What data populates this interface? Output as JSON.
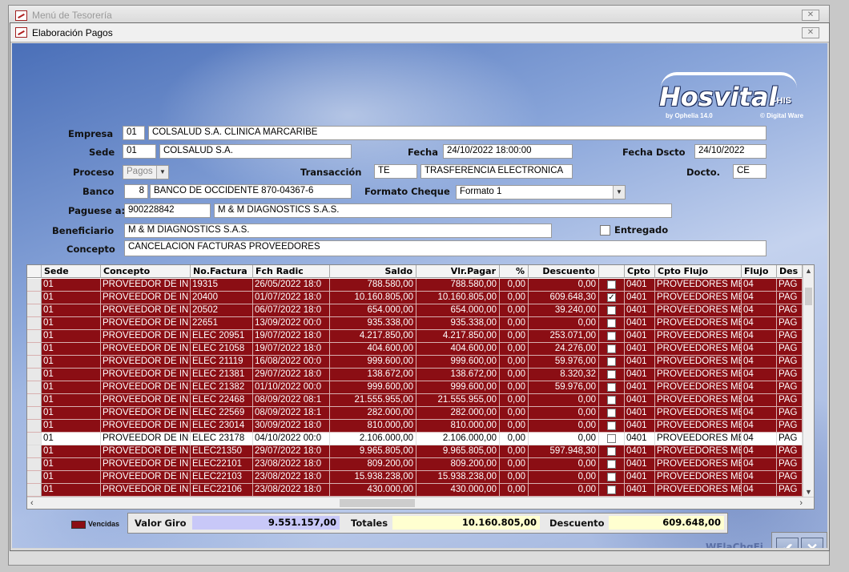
{
  "parent_window": {
    "title": "Menú de Tesorería"
  },
  "dialog": {
    "title": "Elaboración Pagos"
  },
  "logo": {
    "name": "Hosvital",
    "suffix": "-HIS",
    "by": "by Ophelia 14.0",
    "vendor": "© Digital Ware"
  },
  "form": {
    "empresa": {
      "label": "Empresa",
      "code": "01",
      "name": "COLSALUD S.A. CLINICA MARCARIBE"
    },
    "sede": {
      "label": "Sede",
      "code": "01",
      "name": "COLSALUD S.A."
    },
    "fecha": {
      "label": "Fecha",
      "value": "24/10/2022 18:00:00"
    },
    "fecha_dscto": {
      "label": "Fecha Dscto",
      "value": "24/10/2022"
    },
    "proceso": {
      "label": "Proceso",
      "value": "Pagos"
    },
    "transaccion": {
      "label": "Transacción",
      "code": "TE",
      "name": "TRASFERENCIA ELECTRONICA"
    },
    "docto": {
      "label": "Docto.",
      "value": "CE"
    },
    "banco": {
      "label": "Banco",
      "code": "8",
      "name": "BANCO DE OCCIDENTE 870-04367-6"
    },
    "formato_cheque": {
      "label": "Formato Cheque",
      "value": "Formato 1"
    },
    "paguese": {
      "label": "Paguese a:",
      "nit": "900228842",
      "name": "M & M DIAGNOSTICS S.A.S."
    },
    "beneficiario": {
      "label": "Beneficiario",
      "value": "M & M DIAGNOSTICS S.A.S."
    },
    "entregado": {
      "label": "Entregado",
      "checked": false
    },
    "concepto": {
      "label": "Concepto",
      "value": "CANCELACION FACTURAS PROVEEDORES"
    }
  },
  "grid": {
    "columns": [
      "Sede",
      "Concepto",
      "No.Factura",
      "Fch Radic",
      "Saldo",
      "Vlr.Pagar",
      "%",
      "Descuento",
      "",
      "Cpto",
      "Cpto Flujo",
      "Flujo",
      "Des"
    ],
    "rows": [
      {
        "sede": "01",
        "concepto": "PROVEEDOR DE  IN",
        "factura": "19315",
        "fecha": "26/05/2022 18:0",
        "saldo": "788.580,00",
        "vlr": "788.580,00",
        "pct": "0,00",
        "desc": "0,00",
        "chk": "",
        "cpto": "0401",
        "flujo_cpto": "PROVEEDORES ME",
        "flujo": "04",
        "des": "PAG",
        "vencida": true
      },
      {
        "sede": "01",
        "concepto": "PROVEEDOR DE  IN",
        "factura": "20400",
        "fecha": "01/07/2022 18:0",
        "saldo": "10.160.805,00",
        "vlr": "10.160.805,00",
        "pct": "0,00",
        "desc": "609.648,30",
        "chk": "✓",
        "cpto": "0401",
        "flujo_cpto": "PROVEEDORES ME",
        "flujo": "04",
        "des": "PAG",
        "vencida": true
      },
      {
        "sede": "01",
        "concepto": "PROVEEDOR DE  IN",
        "factura": "20502",
        "fecha": "06/07/2022 18:0",
        "saldo": "654.000,00",
        "vlr": "654.000,00",
        "pct": "0,00",
        "desc": "39.240,00",
        "chk": "",
        "cpto": "0401",
        "flujo_cpto": "PROVEEDORES ME",
        "flujo": "04",
        "des": "PAG",
        "vencida": true
      },
      {
        "sede": "01",
        "concepto": "PROVEEDOR DE  IN",
        "factura": "22651",
        "fecha": "13/09/2022 00:0",
        "saldo": "935.338,00",
        "vlr": "935.338,00",
        "pct": "0,00",
        "desc": "0,00",
        "chk": "",
        "cpto": "0401",
        "flujo_cpto": "PROVEEDORES ME",
        "flujo": "04",
        "des": "PAG",
        "vencida": true
      },
      {
        "sede": "01",
        "concepto": "PROVEEDOR DE  IN",
        "factura": "ELEC 20951",
        "fecha": "19/07/2022 18:0",
        "saldo": "4.217.850,00",
        "vlr": "4.217.850,00",
        "pct": "0,00",
        "desc": "253.071,00",
        "chk": "",
        "cpto": "0401",
        "flujo_cpto": "PROVEEDORES ME",
        "flujo": "04",
        "des": "PAG",
        "vencida": true
      },
      {
        "sede": "01",
        "concepto": "PROVEEDOR DE  IN",
        "factura": "ELEC 21058",
        "fecha": "19/07/2022 18:0",
        "saldo": "404.600,00",
        "vlr": "404.600,00",
        "pct": "0,00",
        "desc": "24.276,00",
        "chk": "",
        "cpto": "0401",
        "flujo_cpto": "PROVEEDORES ME",
        "flujo": "04",
        "des": "PAG",
        "vencida": true
      },
      {
        "sede": "01",
        "concepto": "PROVEEDOR DE  IN",
        "factura": "ELEC 21119",
        "fecha": "16/08/2022 00:0",
        "saldo": "999.600,00",
        "vlr": "999.600,00",
        "pct": "0,00",
        "desc": "59.976,00",
        "chk": "",
        "cpto": "0401",
        "flujo_cpto": "PROVEEDORES ME",
        "flujo": "04",
        "des": "PAG",
        "vencida": true
      },
      {
        "sede": "01",
        "concepto": "PROVEEDOR DE  IN",
        "factura": "ELEC 21381",
        "fecha": "29/07/2022 18:0",
        "saldo": "138.672,00",
        "vlr": "138.672,00",
        "pct": "0,00",
        "desc": "8.320,32",
        "chk": "",
        "cpto": "0401",
        "flujo_cpto": "PROVEEDORES ME",
        "flujo": "04",
        "des": "PAG",
        "vencida": true
      },
      {
        "sede": "01",
        "concepto": "PROVEEDOR DE  IN",
        "factura": "ELEC 21382",
        "fecha": "01/10/2022 00:0",
        "saldo": "999.600,00",
        "vlr": "999.600,00",
        "pct": "0,00",
        "desc": "59.976,00",
        "chk": "",
        "cpto": "0401",
        "flujo_cpto": "PROVEEDORES ME",
        "flujo": "04",
        "des": "PAG",
        "vencida": true
      },
      {
        "sede": "01",
        "concepto": "PROVEEDOR DE  IN",
        "factura": "ELEC 22468",
        "fecha": "08/09/2022 08:1",
        "saldo": "21.555.955,00",
        "vlr": "21.555.955,00",
        "pct": "0,00",
        "desc": "0,00",
        "chk": "",
        "cpto": "0401",
        "flujo_cpto": "PROVEEDORES ME",
        "flujo": "04",
        "des": "PAG",
        "vencida": true
      },
      {
        "sede": "01",
        "concepto": "PROVEEDOR DE  IN",
        "factura": "ELEC 22569",
        "fecha": "08/09/2022 18:1",
        "saldo": "282.000,00",
        "vlr": "282.000,00",
        "pct": "0,00",
        "desc": "0,00",
        "chk": "",
        "cpto": "0401",
        "flujo_cpto": "PROVEEDORES ME",
        "flujo": "04",
        "des": "PAG",
        "vencida": true
      },
      {
        "sede": "01",
        "concepto": "PROVEEDOR DE  IN",
        "factura": "ELEC 23014",
        "fecha": "30/09/2022 18:0",
        "saldo": "810.000,00",
        "vlr": "810.000,00",
        "pct": "0,00",
        "desc": "0,00",
        "chk": "",
        "cpto": "0401",
        "flujo_cpto": "PROVEEDORES ME",
        "flujo": "04",
        "des": "PAG",
        "vencida": true
      },
      {
        "sede": "01",
        "concepto": "PROVEEDOR DE  IN",
        "factura": "ELEC 23178",
        "fecha": "04/10/2022 00:0",
        "saldo": "2.106.000,00",
        "vlr": "2.106.000,00",
        "pct": "0,00",
        "desc": "0,00",
        "chk": "",
        "cpto": "0401",
        "flujo_cpto": "PROVEEDORES ME",
        "flujo": "04",
        "des": "PAG",
        "vencida": false
      },
      {
        "sede": "01",
        "concepto": "PROVEEDOR DE  IN",
        "factura": "ELEC21350",
        "fecha": "29/07/2022 18:0",
        "saldo": "9.965.805,00",
        "vlr": "9.965.805,00",
        "pct": "0,00",
        "desc": "597.948,30",
        "chk": "",
        "cpto": "0401",
        "flujo_cpto": "PROVEEDORES ME",
        "flujo": "04",
        "des": "PAG",
        "vencida": true
      },
      {
        "sede": "01",
        "concepto": "PROVEEDOR DE  IN",
        "factura": "ELEC22101",
        "fecha": "23/08/2022 18:0",
        "saldo": "809.200,00",
        "vlr": "809.200,00",
        "pct": "0,00",
        "desc": "0,00",
        "chk": "",
        "cpto": "0401",
        "flujo_cpto": "PROVEEDORES ME",
        "flujo": "04",
        "des": "PAG",
        "vencida": true
      },
      {
        "sede": "01",
        "concepto": "PROVEEDOR DE  IN",
        "factura": "ELEC22103",
        "fecha": "23/08/2022 18:0",
        "saldo": "15.938.238,00",
        "vlr": "15.938.238,00",
        "pct": "0,00",
        "desc": "0,00",
        "chk": "",
        "cpto": "0401",
        "flujo_cpto": "PROVEEDORES ME",
        "flujo": "04",
        "des": "PAG",
        "vencida": true
      },
      {
        "sede": "01",
        "concepto": "PROVEEDOR DE  IN",
        "factura": "ELEC22106",
        "fecha": "23/08/2022 18:0",
        "saldo": "430.000,00",
        "vlr": "430.000,00",
        "pct": "0,00",
        "desc": "0,00",
        "chk": "",
        "cpto": "0401",
        "flujo_cpto": "PROVEEDORES ME",
        "flujo": "04",
        "des": "PAG",
        "vencida": true
      }
    ]
  },
  "footer": {
    "legend": "Vencidas",
    "valor_giro": {
      "label": "Valor Giro",
      "value": "9.551.157,00"
    },
    "totales": {
      "label": "Totales",
      "value": "10.160.805,00"
    },
    "descuento": {
      "label": "Descuento",
      "value": "609.648,00"
    },
    "form_code": "WElaChqFj"
  },
  "colors": {
    "vencida_row": "#8b0e14",
    "valor_giro_bg": "#c8c8f8",
    "totales_bg": "#ffffd0"
  }
}
